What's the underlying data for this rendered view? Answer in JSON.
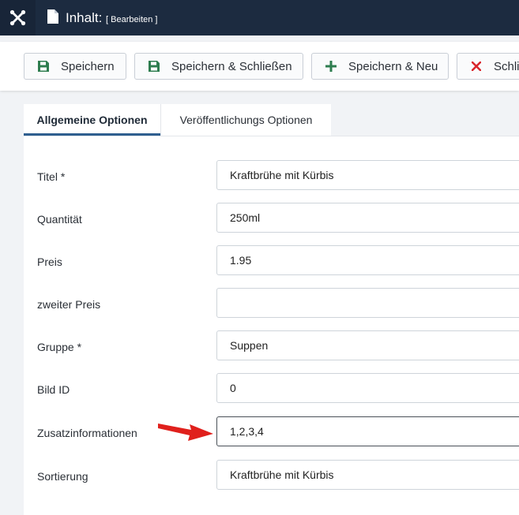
{
  "header": {
    "title": "Inhalt:",
    "subtitle": "[ Bearbeiten ]"
  },
  "toolbar": {
    "save_label": "Speichern",
    "save_close_label": "Speichern & Schließen",
    "save_new_label": "Speichern & Neu",
    "close_label": "Schli"
  },
  "tabs": [
    {
      "label": "Allgemeine Optionen",
      "active": true
    },
    {
      "label": "Veröffentlichungs Optionen",
      "active": false
    }
  ],
  "form": {
    "fields": [
      {
        "label": "Titel *",
        "value": "Kraftbrühe mit Kürbis"
      },
      {
        "label": "Quantität",
        "value": "250ml"
      },
      {
        "label": "Preis",
        "value": "1.95"
      },
      {
        "label": "zweiter Preis",
        "value": ""
      },
      {
        "label": "Gruppe *",
        "value": "Suppen"
      },
      {
        "label": "Bild ID",
        "value": "0"
      },
      {
        "label": "Zusatzinformationen",
        "value": "1,2,3,4"
      },
      {
        "label": "Sortierung",
        "value": "Kraftbrühe mit Kürbis"
      }
    ]
  },
  "colors": {
    "topbar": "#1c2b40",
    "save_icon": "#2e7d4f",
    "close_icon": "#d9262c",
    "tab_accent": "#2f5f8f",
    "annotation_arrow": "#e0201c"
  },
  "icons": {
    "logo": "joomla-logo-icon",
    "page": "file-icon",
    "save": "floppy-disk-icon",
    "new": "plus-icon",
    "close": "close-icon",
    "annotation": "red-arrow-icon"
  }
}
